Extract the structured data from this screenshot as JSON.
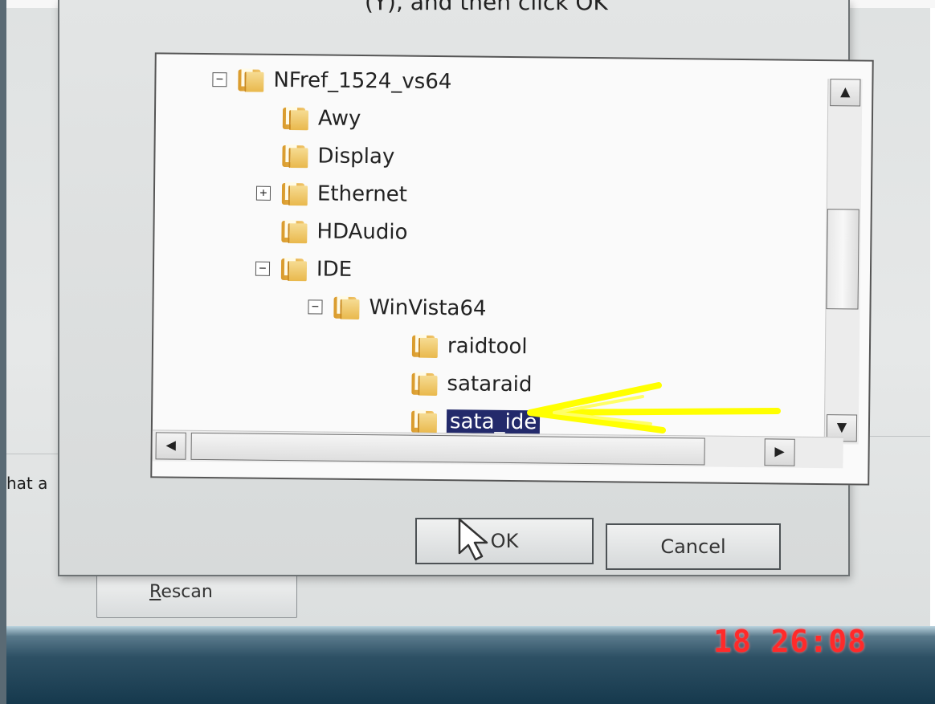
{
  "dialog": {
    "instruction_partial": "(Y), and then click OK",
    "tree": [
      {
        "label": "NFref_1524_vs64",
        "expander": "−",
        "level": 0
      },
      {
        "label": "Awy",
        "expander": "",
        "level": 1
      },
      {
        "label": "Display",
        "expander": "",
        "level": 1
      },
      {
        "label": "Ethernet",
        "expander": "+",
        "level": 1
      },
      {
        "label": "HDAudio",
        "expander": "",
        "level": 1
      },
      {
        "label": "IDE",
        "expander": "−",
        "level": 1
      },
      {
        "label": "WinVista64",
        "expander": "−",
        "level": 2
      },
      {
        "label": "raidtool",
        "expander": "",
        "level": 3
      },
      {
        "label": "sataraid",
        "expander": "",
        "level": 3
      },
      {
        "label": "sata_ide",
        "expander": "",
        "level": 3,
        "selected": true
      }
    ],
    "ok_label": "OK",
    "cancel_label": "Cancel"
  },
  "background": {
    "side_text": "hat a",
    "rescan_prefix": "R",
    "rescan_rest": "escan",
    "timestamp": "18 26:08"
  },
  "colors": {
    "selection": "#232a6b",
    "annotation_arrow": "#ffff00",
    "timestamp": "#ff2a2a"
  },
  "icons": {
    "folder": "folder-icon",
    "cursor": "mouse-pointer-icon",
    "scroll_up": "triangle-up",
    "scroll_down": "triangle-down",
    "scroll_left": "triangle-left",
    "scroll_right": "triangle-right"
  }
}
